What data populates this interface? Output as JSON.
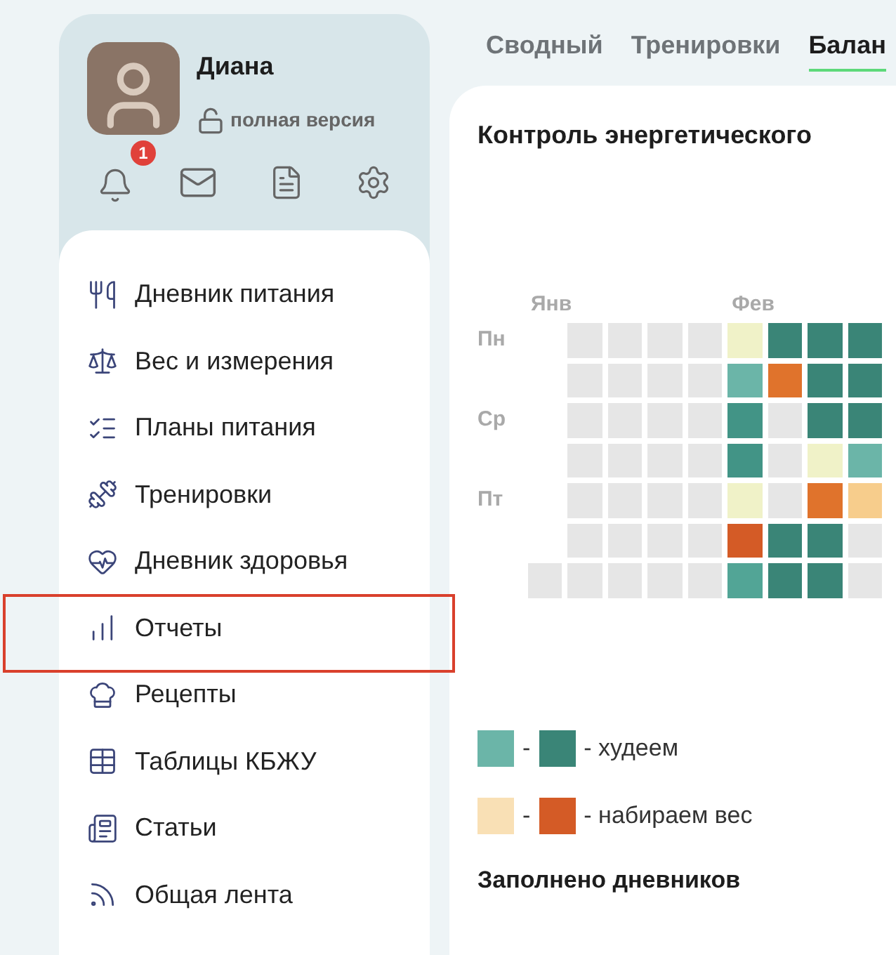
{
  "profile": {
    "name": "Диана",
    "plan": "полная версия",
    "notifications": "1"
  },
  "menu": [
    {
      "label": "Дневник питания",
      "highlighted": false
    },
    {
      "label": "Вес и измерения",
      "highlighted": false
    },
    {
      "label": "Планы питания",
      "highlighted": false
    },
    {
      "label": "Тренировки",
      "highlighted": false
    },
    {
      "label": "Дневник здоровья",
      "highlighted": false
    },
    {
      "label": "Отчеты",
      "highlighted": true
    },
    {
      "label": "Рецепты",
      "highlighted": false
    },
    {
      "label": "Таблицы КБЖУ",
      "highlighted": false
    },
    {
      "label": "Статьи",
      "highlighted": false
    },
    {
      "label": "Общая лента",
      "highlighted": false
    }
  ],
  "tabs": [
    {
      "label": "Сводный",
      "selected": false
    },
    {
      "label": "Тренировки",
      "selected": false
    },
    {
      "label": "Балан",
      "selected": true
    }
  ],
  "card": {
    "title": "Контроль энергетического",
    "months": [
      "Янв",
      "Фев"
    ],
    "rows": [
      {
        "day": "Пн",
        "cells": [
          {
            "color": "#e6e6e6"
          },
          {
            "color": "#e6e6e6"
          },
          {
            "color": "#e6e6e6"
          },
          {
            "color": "#e6e6e6"
          },
          {
            "color": "#f0f2c8"
          },
          {
            "color": "#3a8577"
          },
          {
            "color": "#3a8577"
          },
          {
            "color": "#3a8577"
          }
        ]
      },
      {
        "cells": [
          {
            "color": "#e6e6e6"
          },
          {
            "color": "#e6e6e6"
          },
          {
            "color": "#e6e6e6"
          },
          {
            "color": "#e6e6e6"
          },
          {
            "color": "#6bb5a8"
          },
          {
            "color": "#e0732c"
          },
          {
            "color": "#3a8577"
          },
          {
            "color": "#3a8577"
          }
        ]
      },
      {
        "day": "Ср",
        "cells": [
          {
            "color": "#e6e6e6"
          },
          {
            "color": "#e6e6e6"
          },
          {
            "color": "#e6e6e6"
          },
          {
            "color": "#e6e6e6"
          },
          {
            "color": "#429486"
          },
          {
            "color": "#e6e6e6"
          },
          {
            "color": "#3a8577"
          },
          {
            "color": "#3a8577"
          }
        ]
      },
      {
        "cells": [
          {
            "color": "#e6e6e6"
          },
          {
            "color": "#e6e6e6"
          },
          {
            "color": "#e6e6e6"
          },
          {
            "color": "#e6e6e6"
          },
          {
            "color": "#429486"
          },
          {
            "color": "#e6e6e6"
          },
          {
            "color": "#f0f2c8"
          },
          {
            "color": "#6bb5a8"
          }
        ]
      },
      {
        "day": "Пт",
        "cells": [
          {
            "color": "#e6e6e6"
          },
          {
            "color": "#e6e6e6"
          },
          {
            "color": "#e6e6e6"
          },
          {
            "color": "#e6e6e6"
          },
          {
            "color": "#f0f2c8"
          },
          {
            "color": "#e6e6e6"
          },
          {
            "color": "#e0732c"
          },
          {
            "color": "#f7cd8c"
          }
        ]
      },
      {
        "cells": [
          {
            "color": "#e6e6e6"
          },
          {
            "color": "#e6e6e6"
          },
          {
            "color": "#e6e6e6"
          },
          {
            "color": "#e6e6e6"
          },
          {
            "color": "#d45b26"
          },
          {
            "color": "#3a8577"
          },
          {
            "color": "#3a8577"
          },
          {
            "color": "#e6e6e6"
          }
        ]
      },
      {
        "cells": [
          {
            "color": "#e6e6e6"
          },
          {
            "color": "#e6e6e6"
          },
          {
            "color": "#e6e6e6"
          },
          {
            "color": "#e6e6e6"
          },
          {
            "color": "#e6e6e6"
          },
          {
            "color": "#52a596"
          },
          {
            "color": "#3a8577"
          },
          {
            "color": "#3a8577"
          },
          {
            "color": "#e6e6e6"
          }
        ]
      }
    ],
    "legend": [
      {
        "swatches": [
          {
            "color": "#6bb5a8"
          },
          {
            "color": "#3a8577"
          }
        ],
        "dash": "-",
        "label": "- худеем"
      },
      {
        "swatches": [
          {
            "color": "#f9e0b5"
          },
          {
            "color": "#d45b26"
          }
        ],
        "dash": "-",
        "label": "- набираем вес"
      }
    ],
    "subtitle": "Заполнено дневников"
  }
}
